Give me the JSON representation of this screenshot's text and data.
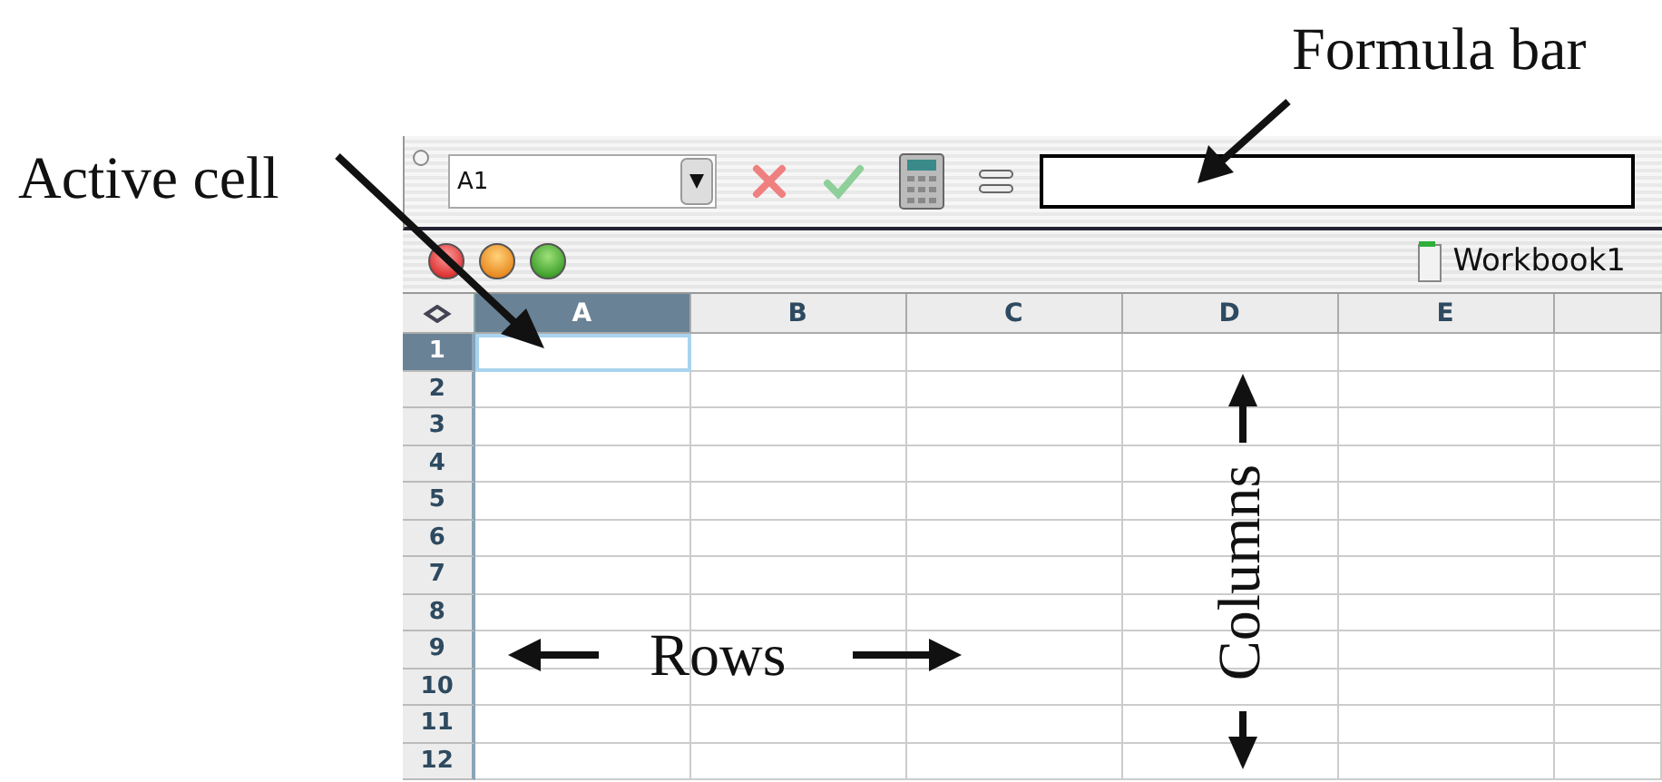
{
  "annotations": {
    "active_cell": "Active cell",
    "formula_bar": "Formula bar",
    "rows": "Rows",
    "columns": "Columns"
  },
  "toolbar": {
    "name_box": "A1"
  },
  "window": {
    "title": "Workbook1"
  },
  "sheet": {
    "columns": [
      {
        "label": "A",
        "selected": true
      },
      {
        "label": "B",
        "selected": false
      },
      {
        "label": "C",
        "selected": false
      },
      {
        "label": "D",
        "selected": false
      },
      {
        "label": "E",
        "selected": false
      }
    ],
    "rows": [
      {
        "label": "1",
        "selected": true
      },
      {
        "label": "2",
        "selected": false
      },
      {
        "label": "3",
        "selected": false
      },
      {
        "label": "4",
        "selected": false
      },
      {
        "label": "5",
        "selected": false
      },
      {
        "label": "6",
        "selected": false
      },
      {
        "label": "7",
        "selected": false
      },
      {
        "label": "8",
        "selected": false
      },
      {
        "label": "9",
        "selected": false
      },
      {
        "label": "10",
        "selected": false
      },
      {
        "label": "11",
        "selected": false
      },
      {
        "label": "12",
        "selected": false
      }
    ]
  }
}
